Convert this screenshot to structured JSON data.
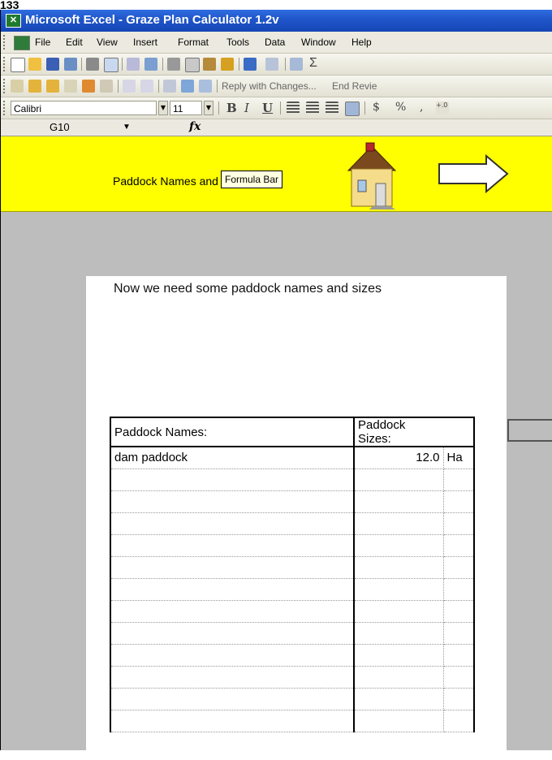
{
  "page_label": "133",
  "window": {
    "title": "Microsoft Excel - Graze Plan Calculator 1.2v",
    "menu": [
      "File",
      "Edit",
      "View",
      "Insert",
      "Format",
      "Tools",
      "Data",
      "Window",
      "Help"
    ]
  },
  "reviewing_toolbar": {
    "reply_label": "Reply with Changes...",
    "end_review_label": "End Revie"
  },
  "formatting": {
    "font": "Calibri",
    "size": "11",
    "bold": "B",
    "italic": "I",
    "underline": "U",
    "currency": "$",
    "percent": "%",
    "comma": ","
  },
  "formula_bar": {
    "cell_ref": "G10",
    "fx": "fx",
    "tooltip": "Formula Bar"
  },
  "banner": {
    "title": "Paddock Names and Sizes"
  },
  "sheet": {
    "instruction": "Now we need some paddock names and sizes",
    "table": {
      "headers": [
        "Paddock Names:",
        "Paddock Sizes:"
      ],
      "rows": [
        {
          "name": "dam paddock",
          "size": "12.0",
          "unit": "Ha"
        },
        {
          "name": "",
          "size": "",
          "unit": ""
        },
        {
          "name": "",
          "size": "",
          "unit": ""
        },
        {
          "name": "",
          "size": "",
          "unit": ""
        },
        {
          "name": "",
          "size": "",
          "unit": ""
        },
        {
          "name": "",
          "size": "",
          "unit": ""
        },
        {
          "name": "",
          "size": "",
          "unit": ""
        },
        {
          "name": "",
          "size": "",
          "unit": ""
        },
        {
          "name": "",
          "size": "",
          "unit": ""
        },
        {
          "name": "",
          "size": "",
          "unit": ""
        },
        {
          "name": "",
          "size": "",
          "unit": ""
        },
        {
          "name": "",
          "size": "",
          "unit": ""
        },
        {
          "name": "",
          "size": "",
          "unit": ""
        }
      ]
    }
  },
  "colors": {
    "titlebar": "#1f55c9",
    "banner": "#ffff00",
    "background": "#bdbdbd"
  }
}
